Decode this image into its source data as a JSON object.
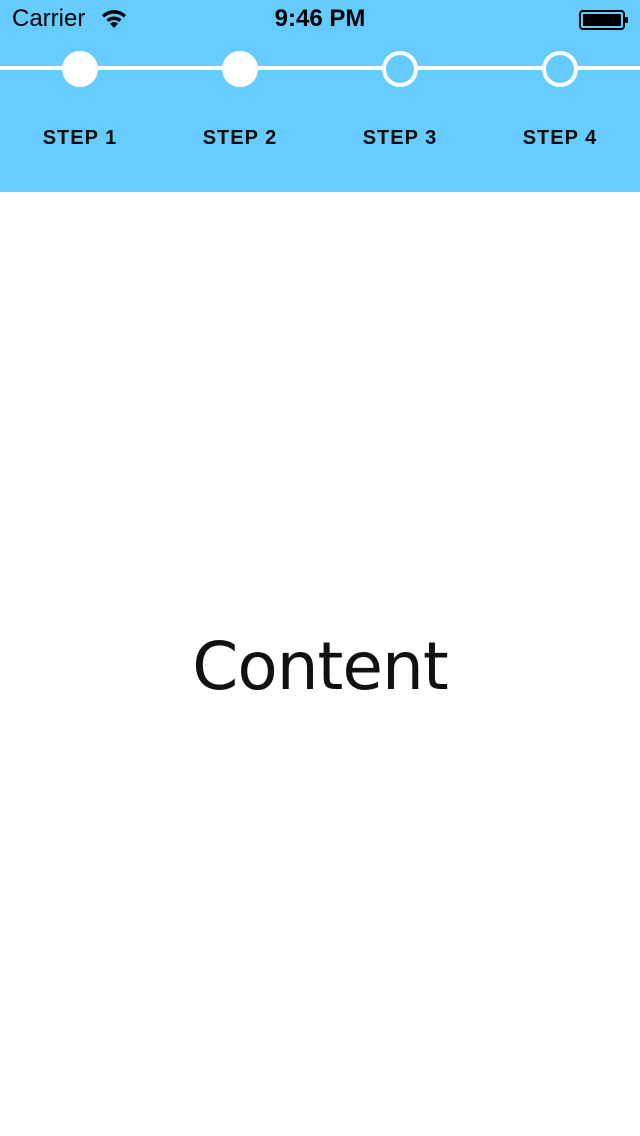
{
  "status_bar": {
    "carrier": "Carrier",
    "time": "9:46 PM",
    "wifi_icon": "wifi-icon",
    "battery_icon": "battery-icon",
    "battery_level": 1.0
  },
  "stepper": {
    "accent_color": "#66CCFF",
    "steps": [
      {
        "label": "STEP 1",
        "completed": true
      },
      {
        "label": "STEP 2",
        "completed": true
      },
      {
        "label": "STEP 3",
        "completed": false
      },
      {
        "label": "STEP 4",
        "completed": false
      }
    ]
  },
  "main": {
    "content_text": "Content"
  }
}
